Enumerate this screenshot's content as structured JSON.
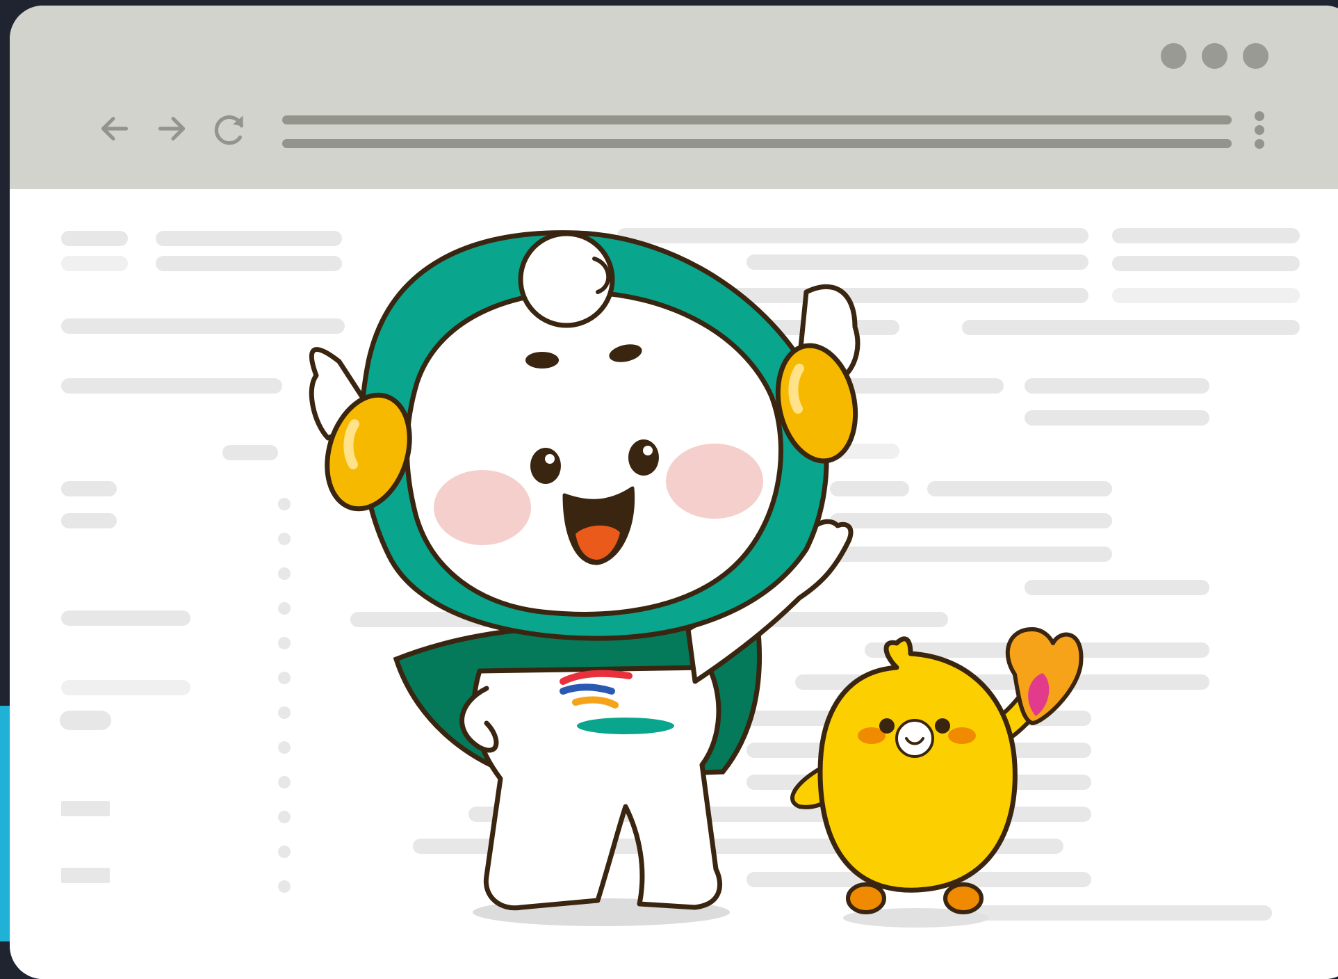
{
  "window": {
    "controls": [
      "window-dot",
      "window-dot",
      "window-dot"
    ]
  },
  "toolbar": {
    "back_icon": "arrow-left-icon",
    "forward_icon": "arrow-right-icon",
    "reload_icon": "reload-icon",
    "menu_icon": "kebab-menu-icon"
  },
  "address_bar": {
    "value": ""
  },
  "page": {
    "state": "placeholder-skeleton"
  },
  "illustration": {
    "subjects": [
      "green-hooded-winged-mascot",
      "yellow-chick-mascot"
    ],
    "colors": {
      "hood": "#0aa58d",
      "cape": "#057a5a",
      "chick": "#fccf00",
      "cheek": "#f4cfcc",
      "ear": "#f7b900"
    }
  },
  "colors": {
    "chrome": "#d2d3cc",
    "chrome_control": "#93958d",
    "placeholder": "#e7e7e7",
    "page_bg": "#ffffff",
    "frame_bg": "#1f2430",
    "accent_corner": "#1fb2d6"
  }
}
